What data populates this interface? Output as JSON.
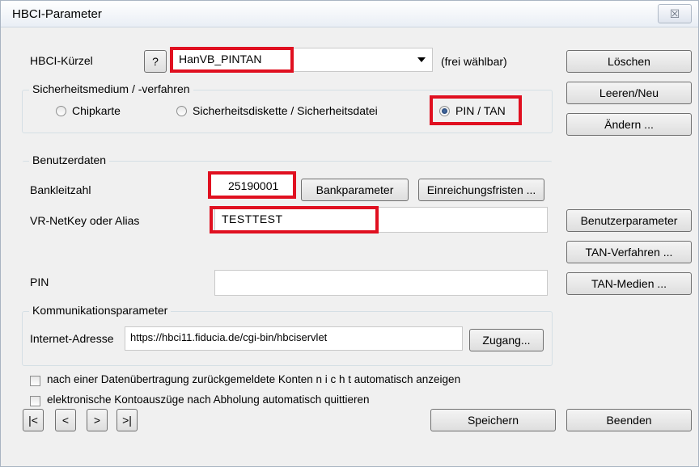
{
  "window": {
    "title": "HBCI-Parameter",
    "close_label": "☒"
  },
  "hbci": {
    "label": "HBCI-Kürzel",
    "help_label": "?",
    "value": "HanVB_PINTAN",
    "hint": "(frei wählbar)"
  },
  "security": {
    "group_title": "Sicherheitsmedium / -verfahren",
    "options": [
      {
        "label": "Chipkarte",
        "selected": false
      },
      {
        "label": "Sicherheitsdiskette / Sicherheitsdatei",
        "selected": false
      },
      {
        "label": "PIN / TAN",
        "selected": true
      }
    ]
  },
  "userdata": {
    "group_title": "Benutzerdaten",
    "blz_label": "Bankleitzahl",
    "blz_value": "25190001",
    "bankparameter_button": "Bankparameter",
    "einreichungsfristen_button": "Einreichungsfristen ...",
    "netkey_label": "VR-NetKey oder Alias",
    "netkey_value": "TESTTEST",
    "pin_label": "PIN",
    "pin_value": ""
  },
  "communication": {
    "group_title": "Kommunikationsparameter",
    "address_label": "Internet-Adresse",
    "address_value": "https://hbci11.fiducia.de/cgi-bin/hbciservlet",
    "zugang_button": "Zugang..."
  },
  "checkboxes": [
    {
      "label": "nach einer Datenübertragung zurückgemeldete Konten  n i c h t  automatisch anzeigen",
      "checked": false
    },
    {
      "label": "elektronische Kontoauszüge nach Abholung automatisch quittieren",
      "checked": false
    }
  ],
  "side_buttons": {
    "loeschen": "Löschen",
    "leeren": "Leeren/Neu",
    "aendern": "Ändern ...",
    "benutzerparameter": "Benutzerparameter",
    "tan_verfahren": "TAN-Verfahren ...",
    "tan_medien": "TAN-Medien ..."
  },
  "navigation": {
    "first": "|<",
    "prev": "<",
    "next": ">",
    "last": ">|"
  },
  "footer": {
    "save": "Speichern",
    "quit": "Beenden"
  },
  "colors": {
    "highlight": "#e01020",
    "dialog_bg": "#f0f0f0"
  }
}
